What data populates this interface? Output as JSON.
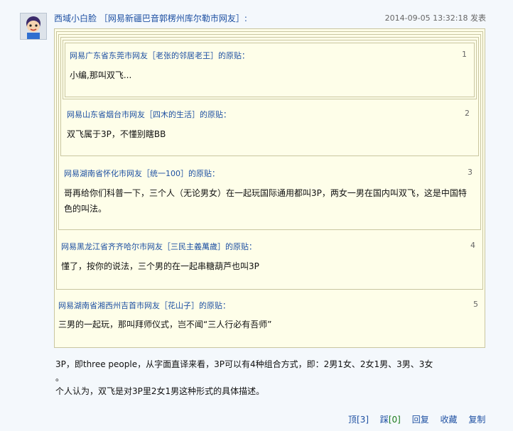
{
  "post": {
    "author": "西域小白脸",
    "location": "［网易新疆巴音郭楞州库尔勒市网友］:",
    "time": "2014-09-05 13:32:18 发表",
    "quotes": [
      {
        "header": "网易广东省东莞市网友［老张的邻居老王］的原贴：",
        "num": "1",
        "text": "小编,那叫双飞..."
      },
      {
        "header": "网易山东省烟台市网友［四木的生活］的原贴：",
        "num": "2",
        "text": "双飞属于3P，不懂别瞎BB"
      },
      {
        "header": "网易湖南省怀化市网友［统一100］的原贴：",
        "num": "3",
        "text": "哥再给你们科普一下，三个人（无论男女）在一起玩国际通用都叫3P，两女一男在国内叫双飞，这是中国特色的叫法。"
      },
      {
        "header": "网易黑龙江省齐齐哈尔市网友［三民主義萬歲］的原贴：",
        "num": "4",
        "text": "懂了，按你的说法，三个男的在一起串糖葫芦也叫3P"
      },
      {
        "header": "网易湖南省湘西州吉首市网友［花山子］的原贴：",
        "num": "5",
        "text": "三男的一起玩，那叫拜师仪式，岂不闻“三人行必有吾师”"
      }
    ],
    "reply_line1": "3P，即three people，从字面直译来看，3P可以有4种组合方式，即：2男1女、2女1男、3男、3女",
    "reply_line2": "。",
    "reply_line3": "个人认为，双飞是对3P里2女1男这种形式的具体描述。",
    "actions": {
      "up_label": "顶",
      "up_count": "[3]",
      "down_label": "踩",
      "down_count": "[0]",
      "reply": "回复",
      "collect": "收藏",
      "copy": "复制"
    }
  }
}
